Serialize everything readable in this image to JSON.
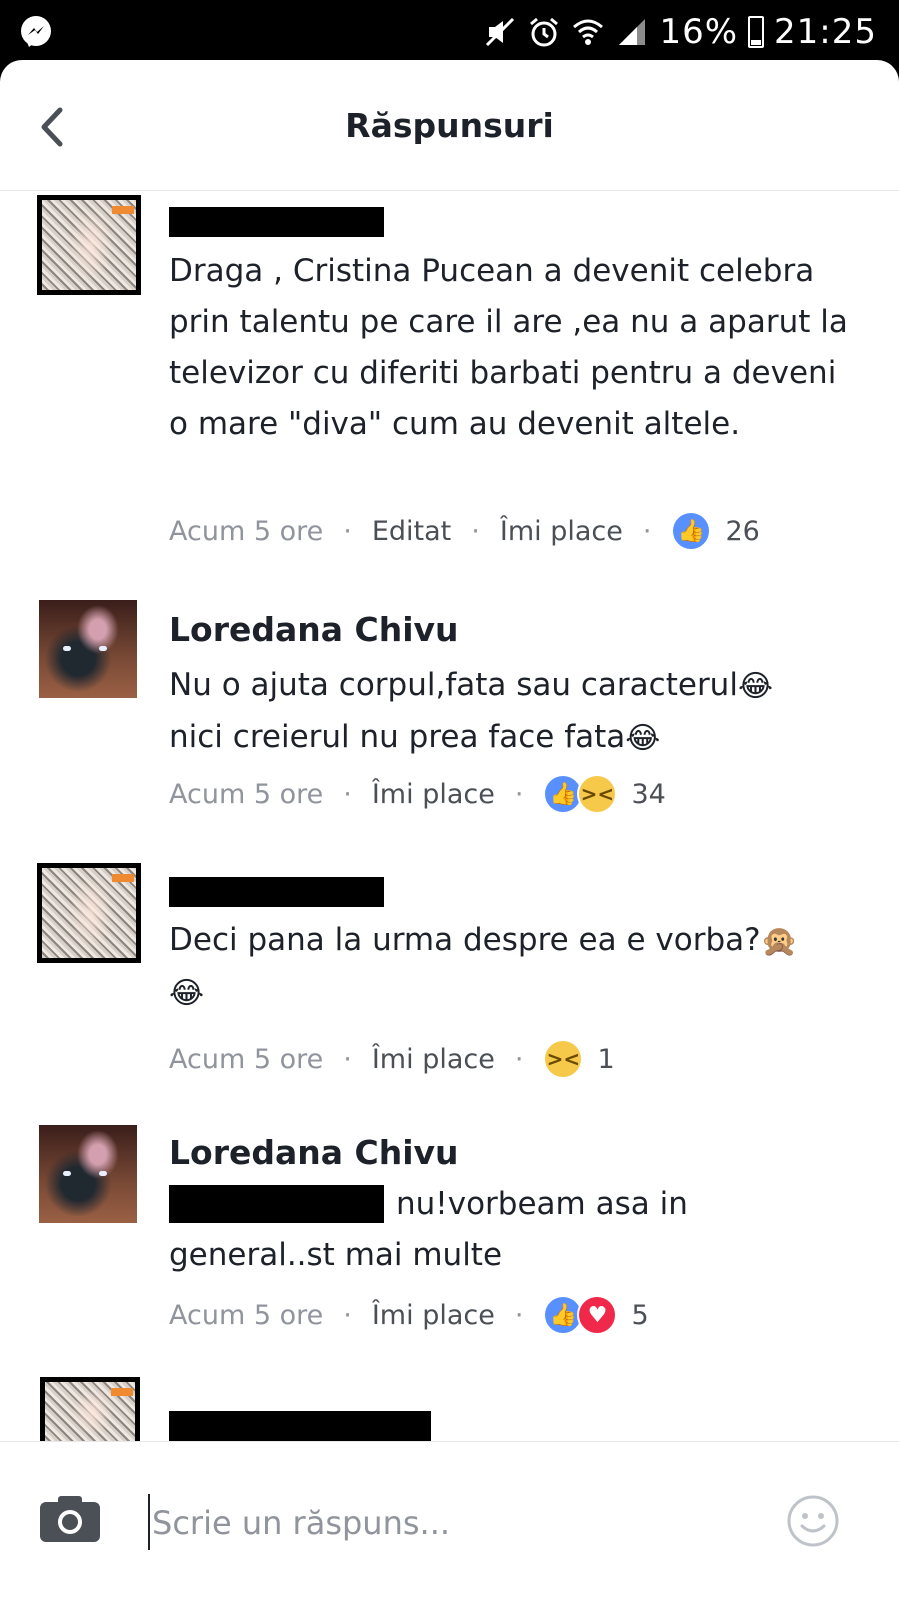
{
  "status_bar": {
    "battery": "16%",
    "time": "21:25",
    "icons": [
      "messenger-icon",
      "mute-icon",
      "alarm-icon",
      "wifi-icon",
      "signal-icon",
      "battery-icon"
    ]
  },
  "header": {
    "title": "Răspunsuri",
    "back_icon": "chevron-left-icon"
  },
  "comments": [
    {
      "author": "",
      "author_redacted": true,
      "text": "Draga , Cristina Pucean a devenit celebra prin talentu pe care il are ,ea nu a aparut la televizor cu diferiti barbati pentru a deveni o mare \"diva\" cum au devenit altele.",
      "time": "Acum 5 ore",
      "edited": "Editat",
      "like_label": "Îmi place",
      "reactions": [
        "like"
      ],
      "reaction_count": "26"
    },
    {
      "author": "Loredana Chivu",
      "author_redacted": false,
      "text": "Nu o ajuta corpul,fata sau caracterul",
      "text_line2": "nici creierul nu prea face fata",
      "emoji": "😂",
      "time": "Acum 5 ore",
      "like_label": "Îmi place",
      "reactions": [
        "like",
        "haha"
      ],
      "reaction_count": "34"
    },
    {
      "author": "",
      "author_redacted": true,
      "text": "Deci pana la urma despre ea e vorba?",
      "emoji_a": "🙊",
      "emoji_b": "😂",
      "time": "Acum 5 ore",
      "like_label": "Îmi place",
      "reactions": [
        "haha"
      ],
      "reaction_count": "1"
    },
    {
      "author": "Loredana Chivu",
      "author_redacted": false,
      "text": "nu!vorbeam asa in general..st mai multe",
      "mention_redacted": true,
      "time": "Acum 5 ore",
      "like_label": "Îmi place",
      "reactions": [
        "like",
        "love"
      ],
      "reaction_count": "5"
    },
    {
      "author": "",
      "author_redacted": true
    }
  ],
  "reply_bar": {
    "placeholder": "Scrie un răspuns...",
    "camera_icon": "camera-icon",
    "emoji_icon": "smiley-icon"
  },
  "colors": {
    "accent_like": "#5890ff",
    "love": "#f0284a",
    "haha": "#f7c94b",
    "text": "#1d2129",
    "meta": "#90949c"
  }
}
